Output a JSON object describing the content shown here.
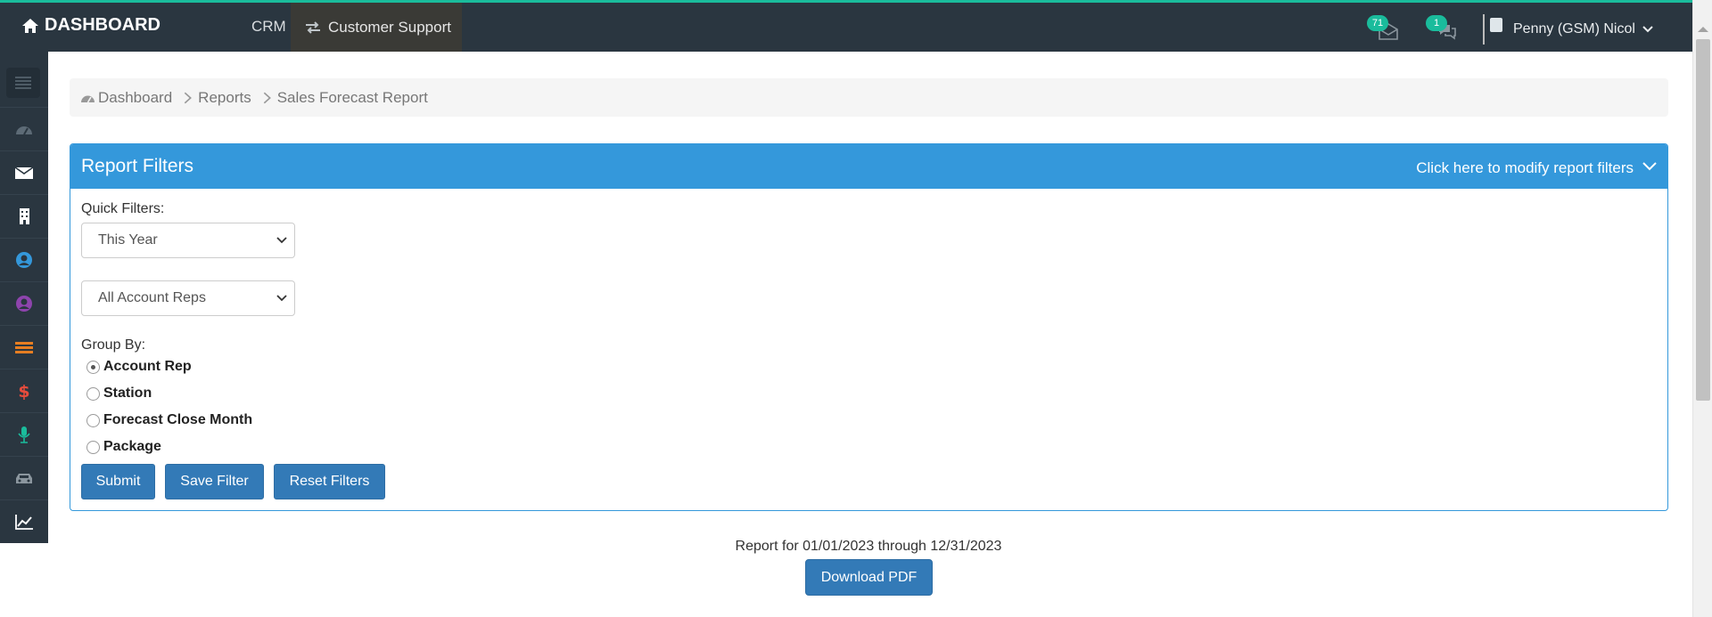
{
  "navbar": {
    "brand": "DASHBOARD",
    "crm_label": "CRM",
    "support_label": "Customer Support",
    "messages_count": "71",
    "chat_count": "1",
    "user_name": "Penny (GSM) Nicol"
  },
  "sidebar": {
    "icons": [
      "menu-icon",
      "dashboard-icon",
      "envelope-icon",
      "building-icon",
      "user-circle-icon",
      "user-circle-purple-icon",
      "list-icon",
      "dollar-icon",
      "microphone-icon",
      "car-icon",
      "line-chart-icon"
    ],
    "colors": {
      "user": "#3498db",
      "user_alt": "#8e44ad",
      "list": "#e67e22",
      "dollar": "#e74c3c",
      "mic": "#1abc9c"
    }
  },
  "breadcrumb": {
    "items": [
      "Dashboard",
      "Reports",
      "Sales Forecast Report"
    ]
  },
  "filters": {
    "title": "Report Filters",
    "toggle_label": "Click here to modify report filters",
    "quick_filters_label": "Quick Filters:",
    "date_select": "This Year",
    "rep_select": "All Account Reps",
    "group_by_label": "Group By:",
    "group_options": [
      "Account Rep",
      "Station",
      "Forecast Close Month",
      "Package"
    ],
    "selected_group": "Account Rep",
    "buttons": {
      "submit": "Submit",
      "save": "Save Filter",
      "reset": "Reset Filters"
    }
  },
  "report": {
    "range_text": "Report for 01/01/2023 through 12/31/2023",
    "download_label": "Download PDF"
  },
  "colors": {
    "navbar": "#2a3640",
    "accent": "#1abc9c",
    "primary": "#3498db",
    "button": "#337ab7"
  }
}
